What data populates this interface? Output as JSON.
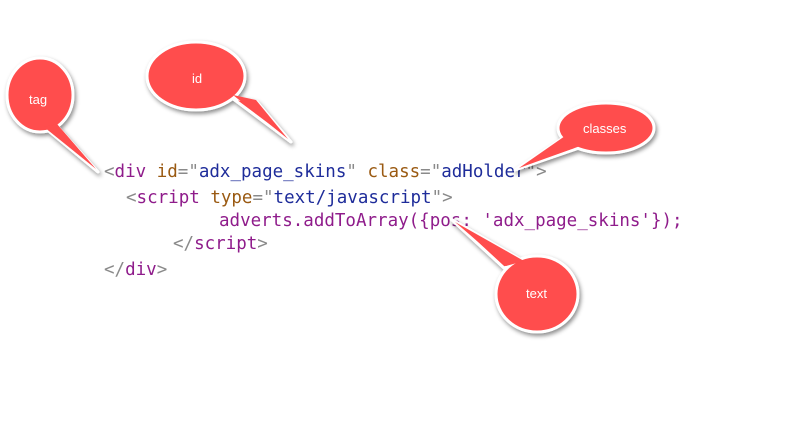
{
  "code": {
    "line1": {
      "open": "<",
      "tag": "div",
      "attr1": "id",
      "eq1": "=\"",
      "val1": "adx_page_skins",
      "close1": "\"",
      "attr2": "class",
      "eq2": "=\"",
      "val2": "adHolder",
      "end": "\">"
    },
    "line2": {
      "open": "<",
      "tag": "script",
      "attr": "type",
      "eq": "=\"",
      "val": "text/javascript",
      "end": "\">"
    },
    "line3": {
      "text": "adverts.addToArray({pos: 'adx_page_skins'});"
    },
    "line4": {
      "open": "</",
      "tag": "script",
      "end": ">"
    },
    "line5": {
      "open": "</",
      "tag": "div",
      "end": ">"
    }
  },
  "callouts": {
    "tag": "tag",
    "id": "id",
    "classes": "classes",
    "text": "text"
  },
  "colors": {
    "callout_fill": "#ff4d4d",
    "callout_stroke": "#ffffff",
    "tag": "#8f1c8b",
    "attribute": "#9a5a12",
    "value": "#1e2c9a",
    "punctuation": "#8a8a8a"
  }
}
